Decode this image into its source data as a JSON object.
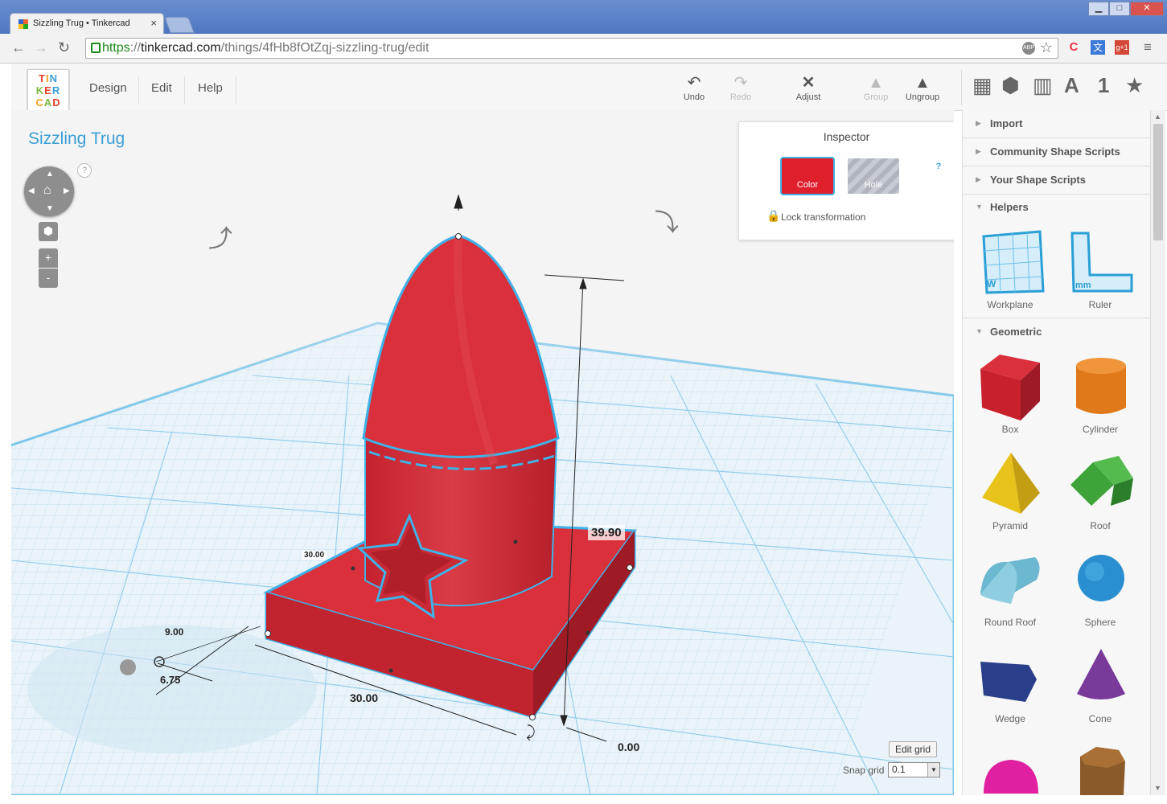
{
  "browser": {
    "tab_title": "Sizzling Trug • Tinkercad",
    "tab_close": "×",
    "url_scheme": "https",
    "url_sep": "://",
    "url_host": "tinkercad.com",
    "url_path": "/things/4fHb8fOtZqj-sizzling-trug/edit",
    "window_buttons": [
      "▁",
      "□",
      "✕"
    ],
    "nav": {
      "back": "←",
      "forward": "→",
      "reload": "↻"
    },
    "extensions": [
      "ABP",
      "☆",
      "C",
      "文",
      "g+1",
      "≡"
    ]
  },
  "app": {
    "logo_rows": [
      "TIN",
      "KER",
      "CAD"
    ],
    "logo_colors": [
      "#e8412c",
      "#f7a21b",
      "#3a9fd6",
      "#7bb83c"
    ],
    "menu": [
      "Design",
      "Edit",
      "Help"
    ],
    "toolbar": {
      "undo": {
        "label": "Undo",
        "icon": "↶"
      },
      "redo": {
        "label": "Redo",
        "icon": "↷"
      },
      "adjust": {
        "label": "Adjust",
        "icon": "✕"
      },
      "group": {
        "label": "Group",
        "icon": "▲"
      },
      "ungroup": {
        "label": "Ungroup",
        "icon": "▲"
      }
    },
    "panel_tabs": [
      "▦",
      "⬢",
      "▥",
      "A",
      "1",
      "★"
    ]
  },
  "workspace": {
    "title": "Sizzling Trug",
    "help_mark": "?",
    "zoom_in": "+",
    "zoom_out": "-",
    "grid_units": "mm",
    "dimensions": {
      "height": "39.90",
      "width_top": "30.00",
      "offset_x": "9.00",
      "offset_y": "6.75",
      "length": "30.00",
      "elevation": "0.00"
    },
    "edit_grid": "Edit grid",
    "snap_grid_label": "Snap grid",
    "snap_grid_value": "0.1",
    "shape_color": "#d9303c",
    "selection_color": "#3fb2e8"
  },
  "inspector": {
    "title": "Inspector",
    "help": "?",
    "color_label": "Color",
    "hole_label": "Hole",
    "lock_label": "Lock transformation"
  },
  "panel": {
    "sections": [
      {
        "label": "Import",
        "expanded": false
      },
      {
        "label": "Community Shape Scripts",
        "expanded": false
      },
      {
        "label": "Your Shape Scripts",
        "expanded": false
      },
      {
        "label": "Helpers",
        "expanded": true
      },
      {
        "label": "Geometric",
        "expanded": true
      }
    ],
    "helpers": [
      {
        "name": "Workplane",
        "glyph": "W"
      },
      {
        "name": "Ruler",
        "glyph": "mm"
      }
    ],
    "geometric": [
      {
        "name": "Box",
        "color": "#c8202c"
      },
      {
        "name": "Cylinder",
        "color": "#e0791a"
      },
      {
        "name": "Pyramid",
        "color": "#e8c31c"
      },
      {
        "name": "Roof",
        "color": "#3ea43a"
      },
      {
        "name": "Round Roof",
        "color": "#6bb8d0"
      },
      {
        "name": "Sphere",
        "color": "#2a8fd0"
      },
      {
        "name": "Wedge",
        "color": "#2a3f8a"
      },
      {
        "name": "Cone",
        "color": "#7a3a9a"
      },
      {
        "name": "Half Sphere",
        "color": "#e020a0"
      },
      {
        "name": "Polygon",
        "color": "#8a5a2a"
      }
    ]
  }
}
